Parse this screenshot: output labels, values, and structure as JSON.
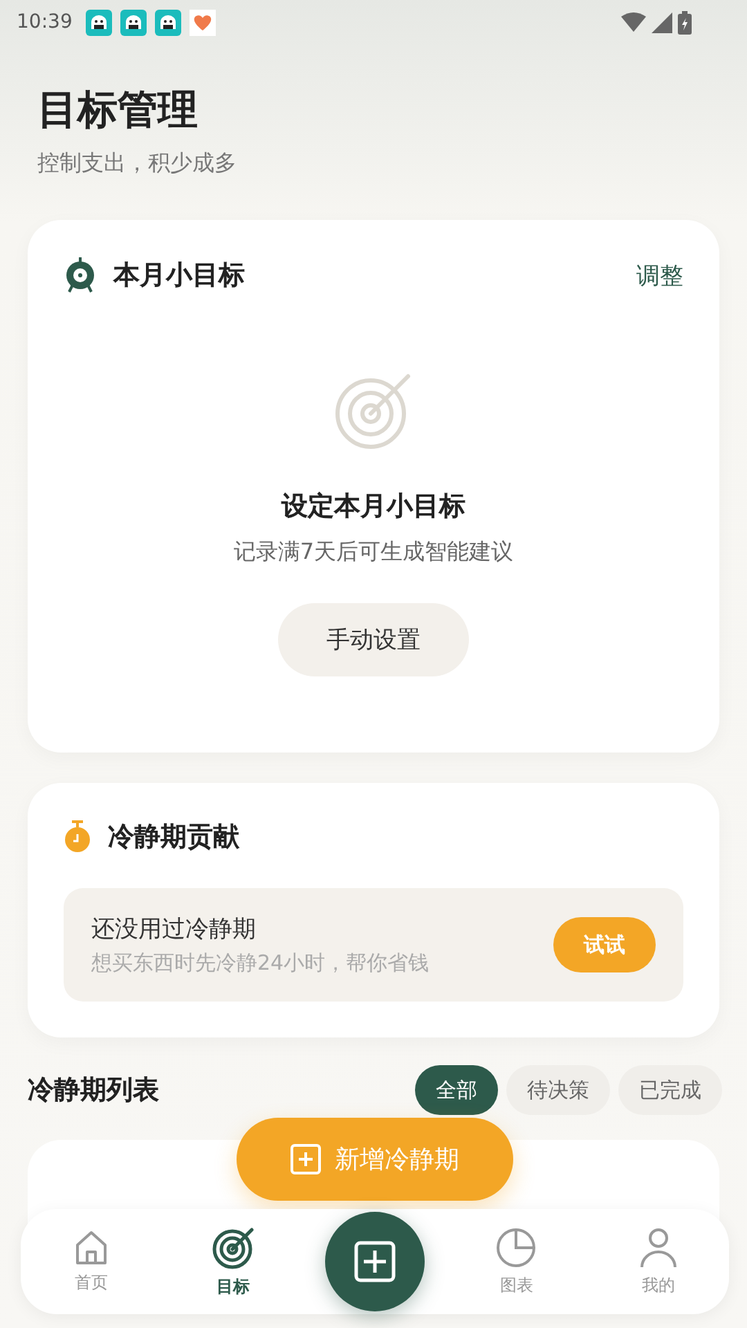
{
  "status_bar": {
    "time": "10:39",
    "notifications": [
      {
        "kind": "bot",
        "color": "#1bbcbc"
      },
      {
        "kind": "bot",
        "color": "#1bbcbc"
      },
      {
        "kind": "bot",
        "color": "#1bbcbc"
      },
      {
        "kind": "heart",
        "color": "#f07a4a"
      }
    ]
  },
  "header": {
    "title": "目标管理",
    "subtitle": "控制支出，积少成多"
  },
  "goal_card": {
    "title": "本月小目标",
    "action": "调整",
    "empty_title": "设定本月小目标",
    "empty_hint": "记录满7天后可生成智能建议",
    "button": "手动设置"
  },
  "cooling_card": {
    "title": "冷静期贡献",
    "prompt_title": "还没用过冷静期",
    "prompt_hint": "想买东西时先冷静24小时，帮你省钱",
    "button": "试试"
  },
  "list": {
    "title": "冷静期列表",
    "filters": [
      {
        "label": "全部",
        "selected": true
      },
      {
        "label": "待决策",
        "selected": false
      },
      {
        "label": "已完成",
        "selected": false
      }
    ]
  },
  "add_button": "新增冷静期",
  "tab_bar": [
    {
      "kind": "home",
      "label": "首页",
      "selected": false
    },
    {
      "kind": "goal",
      "label": "目标",
      "selected": true
    },
    {
      "kind": "add"
    },
    {
      "kind": "chart",
      "label": "图表",
      "selected": false
    },
    {
      "kind": "me",
      "label": "我的",
      "selected": false
    }
  ]
}
